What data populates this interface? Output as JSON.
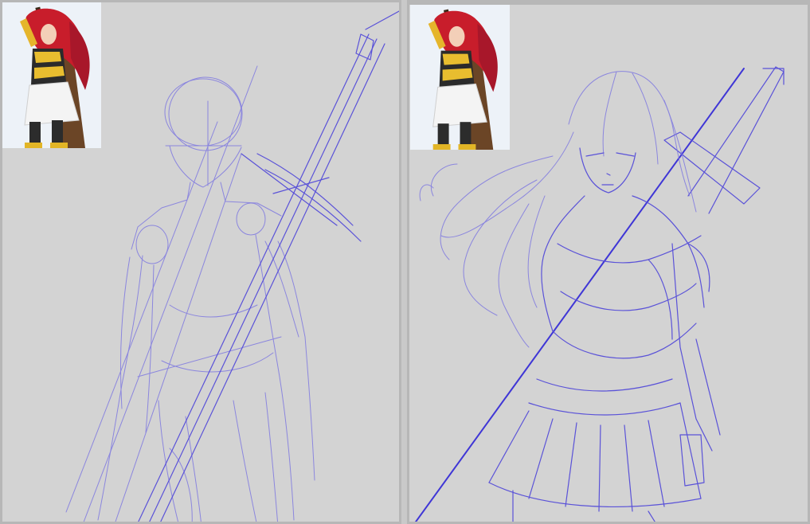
{
  "canvas": {
    "background": "#d3d3d3",
    "sketch_color": "#5a52d8",
    "panels": [
      {
        "id": "left",
        "stage": "rough-gesture-sketch",
        "has_reference_thumbnail": true
      },
      {
        "id": "right",
        "stage": "refined-line-sketch",
        "has_reference_thumbnail": true
      }
    ]
  },
  "reference": {
    "hair_color": "#d11f2a",
    "armor_color": "#e2b526",
    "skirt_color": "#f2f2f2",
    "sword_color": "#6b4526"
  }
}
